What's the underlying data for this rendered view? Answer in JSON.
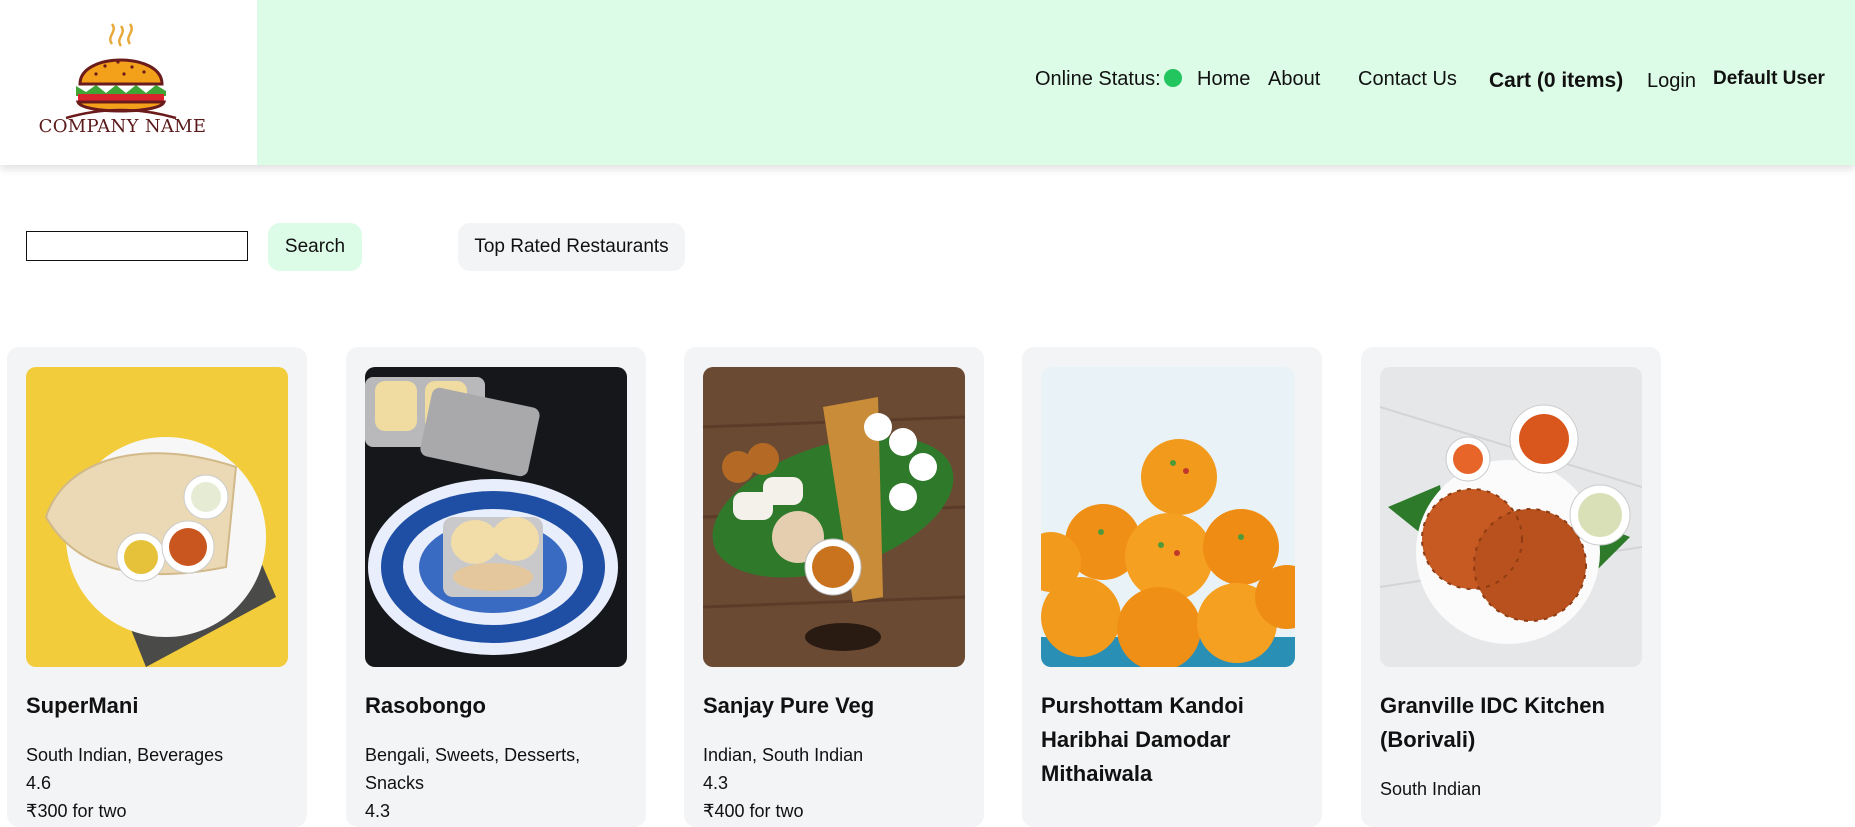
{
  "brand": {
    "company_name": "COMPANY NAME"
  },
  "nav": {
    "online_status_label": "Online Status:",
    "online_status_color": "#22c55e",
    "home": "Home",
    "about": "About",
    "contact": "Contact Us",
    "cart": "Cart (0 items)",
    "login": "Login",
    "user": "Default User"
  },
  "search": {
    "value": "",
    "button_label": "Search"
  },
  "filters": {
    "top_rated_label": "Top Rated Restaurants"
  },
  "colors": {
    "header_bg": "#dcfce7",
    "card_bg": "#f3f4f6",
    "search_btn_bg": "#dcfce7"
  },
  "restaurants": [
    {
      "name": "SuperMani",
      "cuisines": "South Indian, Beverages",
      "rating": "4.6",
      "cost": "₹300 for two"
    },
    {
      "name": "Rasobongo",
      "cuisines": "Bengali, Sweets, Desserts, Snacks",
      "rating": "4.3"
    },
    {
      "name": "Sanjay Pure Veg",
      "cuisines": "Indian, South Indian",
      "rating": "4.3",
      "cost": "₹400 for two"
    },
    {
      "name": "Purshottam Kandoi Haribhai Damodar Mithaiwala",
      "cuisines": ""
    },
    {
      "name": "Granville IDC Kitchen (Borivali)",
      "cuisines": "South Indian"
    }
  ]
}
